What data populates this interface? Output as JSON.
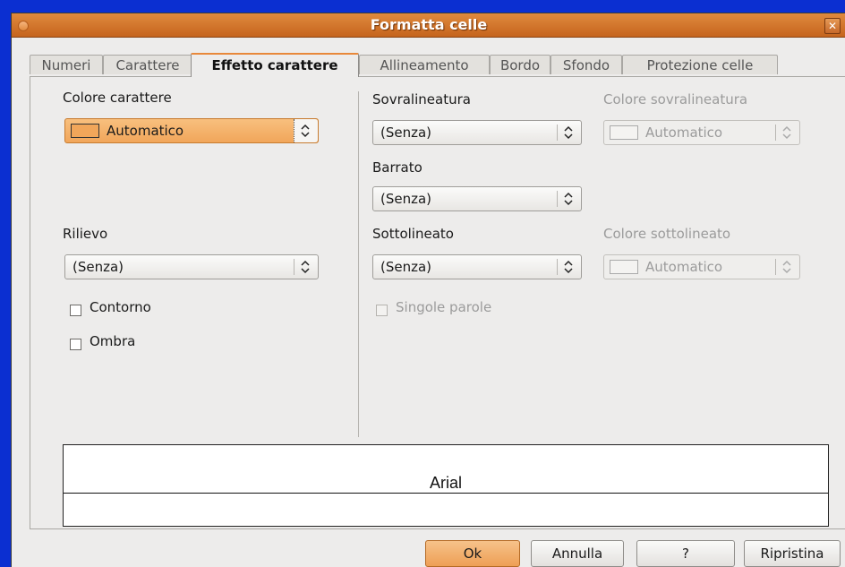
{
  "window": {
    "title": "Formatta celle"
  },
  "tabs": [
    {
      "label": "Numeri"
    },
    {
      "label": "Carattere"
    },
    {
      "label": "Effetto carattere"
    },
    {
      "label": "Allineamento"
    },
    {
      "label": "Bordo"
    },
    {
      "label": "Sfondo"
    },
    {
      "label": "Protezione celle"
    }
  ],
  "active_tab": "Effetto carattere",
  "left": {
    "font_color_label": "Colore carattere",
    "font_color_value": "Automatico",
    "relief_label": "Rilievo",
    "relief_value": "(Senza)",
    "outline_label": "Contorno",
    "shadow_label": "Ombra"
  },
  "right": {
    "overline_label": "Sovralineatura",
    "overline_value": "(Senza)",
    "overline_color_label": "Colore sovralineatura",
    "overline_color_value": "Automatico",
    "strike_label": "Barrato",
    "strike_value": "(Senza)",
    "underline_label": "Sottolineato",
    "underline_value": "(Senza)",
    "underline_color_label": "Colore sottolineato",
    "underline_color_value": "Automatico",
    "single_words_label": "Singole parole"
  },
  "preview": {
    "text": "Arial"
  },
  "buttons": {
    "ok": "Ok",
    "cancel": "Annulla",
    "help": "?",
    "reset": "Ripristina"
  },
  "colors": {
    "accent": "#e8883a",
    "background": "#0b2fd1"
  }
}
